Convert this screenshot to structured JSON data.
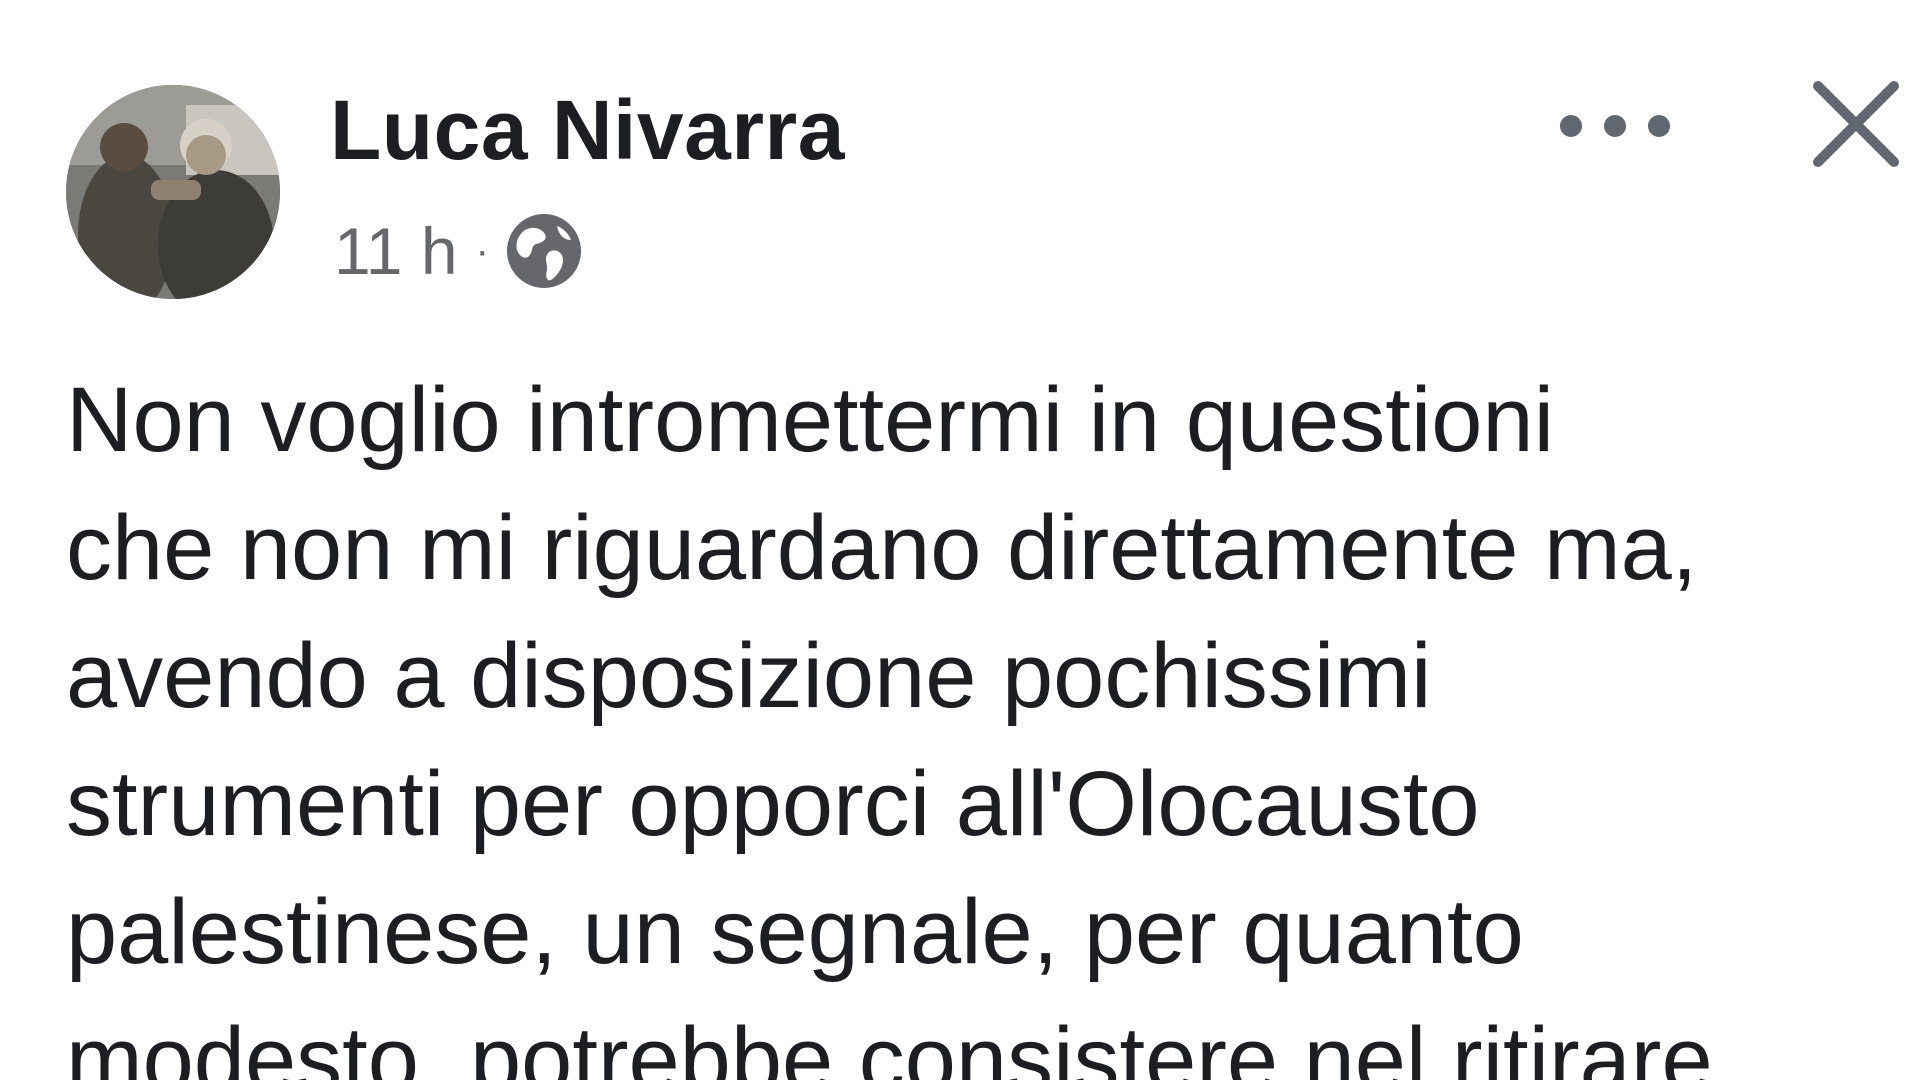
{
  "post": {
    "author": "Luca Nivarra",
    "timestamp": "11 h",
    "separator": "·",
    "audience_icon": "globe-icon",
    "more_icon": "more-options-icon",
    "close_icon": "close-icon",
    "text_lines": [
      "Non voglio intromettermi in questioni",
      "che non mi riguardano direttamente ma,",
      "avendo a disposizione pochissimi",
      "strumenti per opporci all'Olocausto",
      "palestinese, un segnale, per quanto",
      "modesto, potrebbe consistere nel ritirare"
    ]
  },
  "colors": {
    "text_primary": "#1c1e21",
    "text_secondary": "#65676b",
    "icon_gray": "#606770",
    "background": "#ffffff"
  }
}
